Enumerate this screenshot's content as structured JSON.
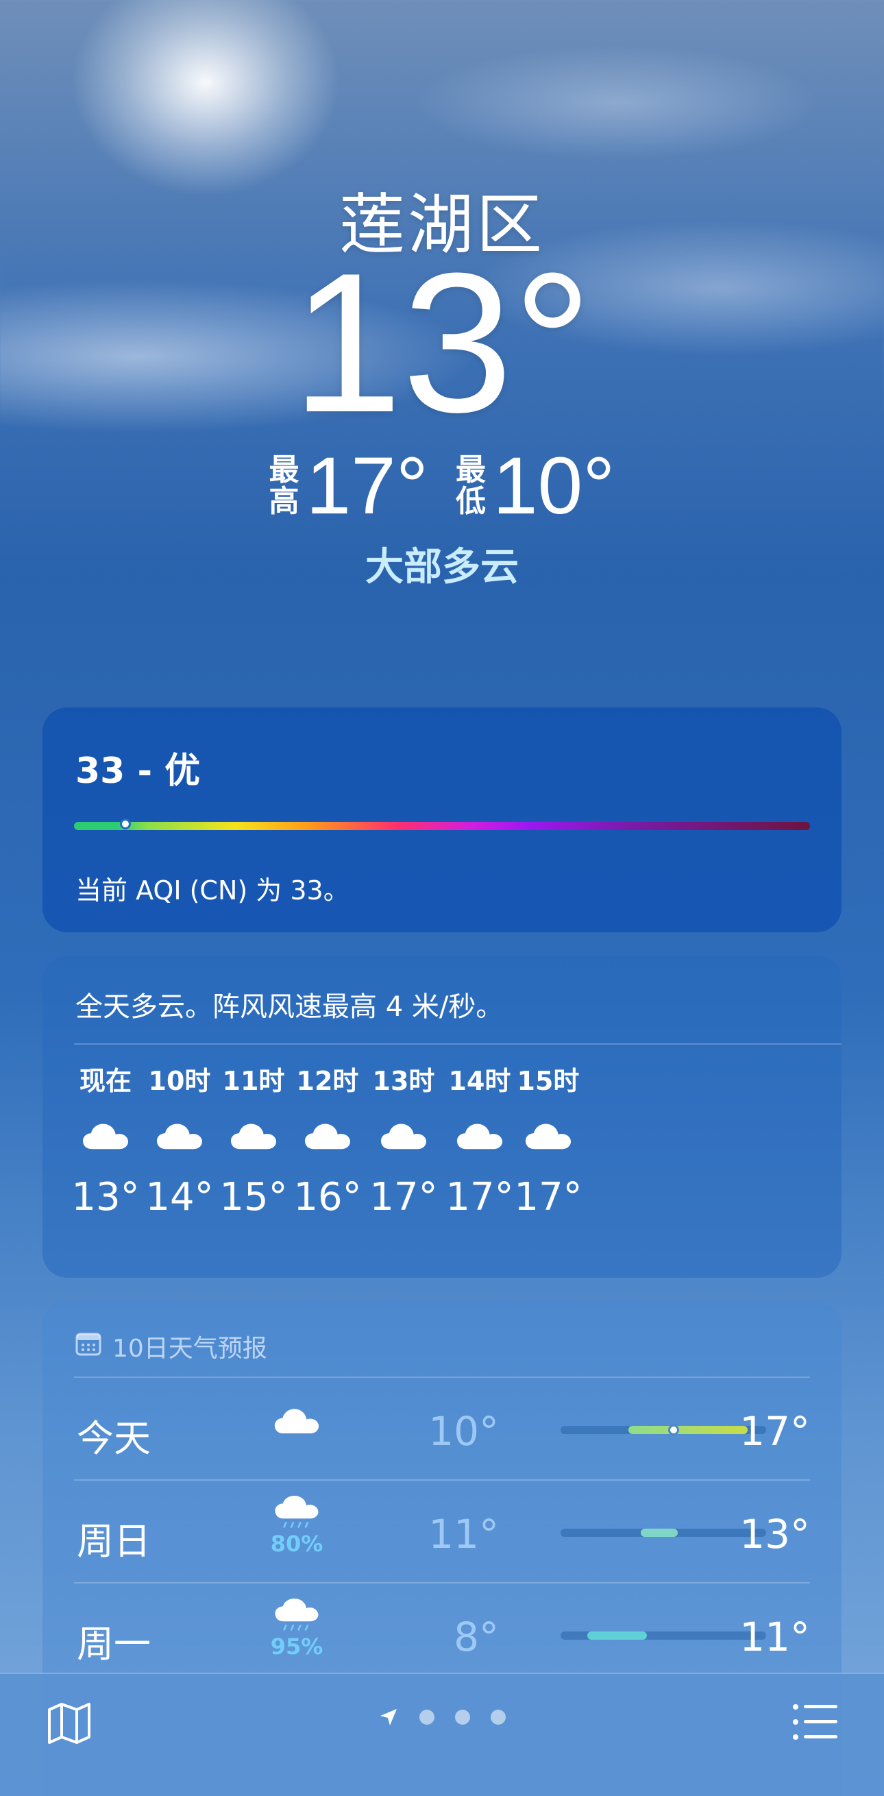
{
  "hero": {
    "location": "莲湖区",
    "current_temp": "13°",
    "high_label_1": "最",
    "high_label_2": "高",
    "high_value": "17°",
    "low_label_1": "最",
    "low_label_2": "低",
    "low_value": "10°",
    "condition": "大部多云"
  },
  "aqi": {
    "title": "33 - 优",
    "description": "当前 AQI (CN) 为 33。",
    "value": 33,
    "indicator_fraction": 0.07
  },
  "hourly": {
    "summary": "全天多云。阵风风速最高 4 米/秒。",
    "items": [
      {
        "label": "现在",
        "icon": "cloud-icon",
        "temp": "13°"
      },
      {
        "label": "10时",
        "icon": "cloud-icon",
        "temp": "14°"
      },
      {
        "label": "11时",
        "icon": "cloud-icon",
        "temp": "15°"
      },
      {
        "label": "12时",
        "icon": "cloud-icon",
        "temp": "16°"
      },
      {
        "label": "13时",
        "icon": "cloud-icon",
        "temp": "17°"
      },
      {
        "label": "14时",
        "icon": "cloud-icon",
        "temp": "17°"
      },
      {
        "label": "15时",
        "icon": "cloud-icon",
        "temp": "17°"
      }
    ]
  },
  "daily": {
    "header": "10日天气预报",
    "rows": [
      {
        "day": "今天",
        "icon": "cloud-icon",
        "precip": "",
        "low": "10°",
        "high": "17°",
        "range_start": 0.33,
        "range_end": 0.91,
        "range_color": "#a6d86a",
        "now": 0.55
      },
      {
        "day": "周日",
        "icon": "cloud-rain-icon",
        "precip": "80%",
        "low": "11°",
        "high": "13°",
        "range_start": 0.39,
        "range_end": 0.57,
        "range_color": "#7fd6c4",
        "now": null
      },
      {
        "day": "周一",
        "icon": "cloud-rain-icon",
        "precip": "95%",
        "low": "8°",
        "high": "11°",
        "range_start": 0.13,
        "range_end": 0.42,
        "range_color": "#5fd0d6",
        "now": null
      }
    ]
  },
  "bottom_bar": {
    "map_icon": "map-icon",
    "location_icon": "location-arrow-icon",
    "list_icon": "list-icon",
    "page_count": 3
  }
}
